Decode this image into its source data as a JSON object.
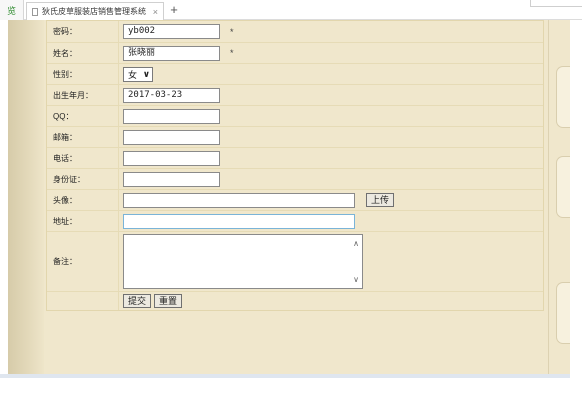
{
  "browser": {
    "side_label": "览",
    "tab_title": "狄氏皮草服装店销售管理系统",
    "tab_close": "×",
    "new_tab": "+"
  },
  "form": {
    "password": {
      "label": "密码：",
      "value": "yb002",
      "required_mark": "*"
    },
    "name": {
      "label": "姓名：",
      "value": "张晓丽",
      "required_mark": "*"
    },
    "gender": {
      "label": "性别：",
      "value": "女"
    },
    "birthdate": {
      "label": "出生年月：",
      "value": "2017-03-23"
    },
    "qq": {
      "label": "QQ：",
      "value": ""
    },
    "email": {
      "label": "邮箱：",
      "value": ""
    },
    "phone": {
      "label": "电话：",
      "value": ""
    },
    "id_card": {
      "label": "身份证：",
      "value": ""
    },
    "avatar": {
      "label": "头像：",
      "value": "",
      "upload_label": "上传"
    },
    "address": {
      "label": "地址：",
      "value": ""
    },
    "remarks": {
      "label": "备注：",
      "value": ""
    },
    "submit_label": "提交",
    "reset_label": "重置"
  }
}
